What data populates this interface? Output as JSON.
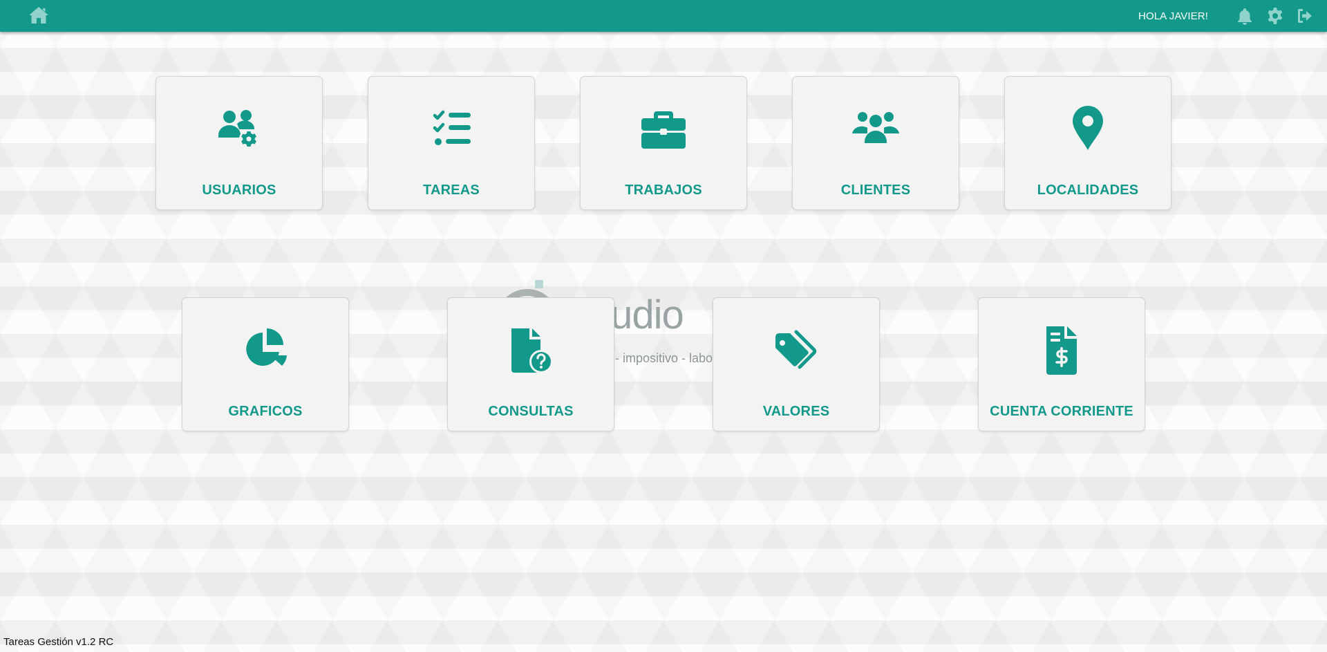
{
  "topbar": {
    "home_icon": "home-icon",
    "greeting": "HOLA JAVIER!",
    "icons": [
      "bell-icon",
      "gear-icon",
      "logout-icon"
    ]
  },
  "watermark": {
    "word": "tudio",
    "subtitle": "- impositivo - labor"
  },
  "menu": {
    "usuarios": "USUARIOS",
    "tareas": "TAREAS",
    "trabajos": "TRABAJOS",
    "clientes": "CLIENTES",
    "localidades": "LOCALIDADES",
    "graficos": "GRAFICOS",
    "consultas": "CONSULTAS",
    "valores": "VALORES",
    "cuenta_corriente": "CUENTA CORRIENTE"
  },
  "footer": {
    "version": "Tareas Gestión v1.2 RC"
  },
  "colors": {
    "accent": "#12998a",
    "card_bg": "#f3f3f3",
    "text_dark": "#111111"
  }
}
